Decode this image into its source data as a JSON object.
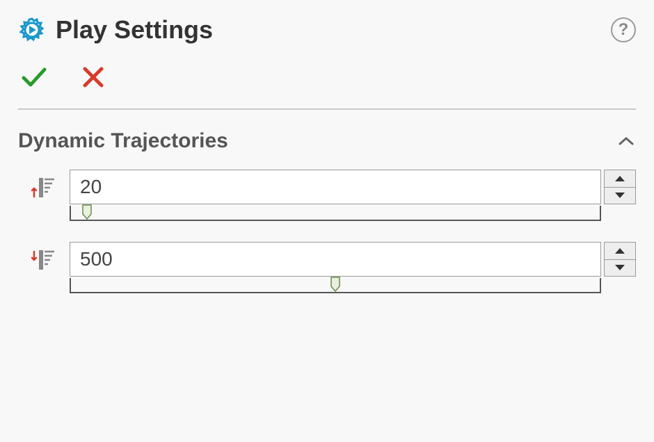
{
  "header": {
    "title": "Play Settings"
  },
  "section": {
    "title": "Dynamic Trajectories"
  },
  "fields": {
    "param1": {
      "value": "20",
      "slider_pct": 3
    },
    "param2": {
      "value": "500",
      "slider_pct": 50
    }
  }
}
